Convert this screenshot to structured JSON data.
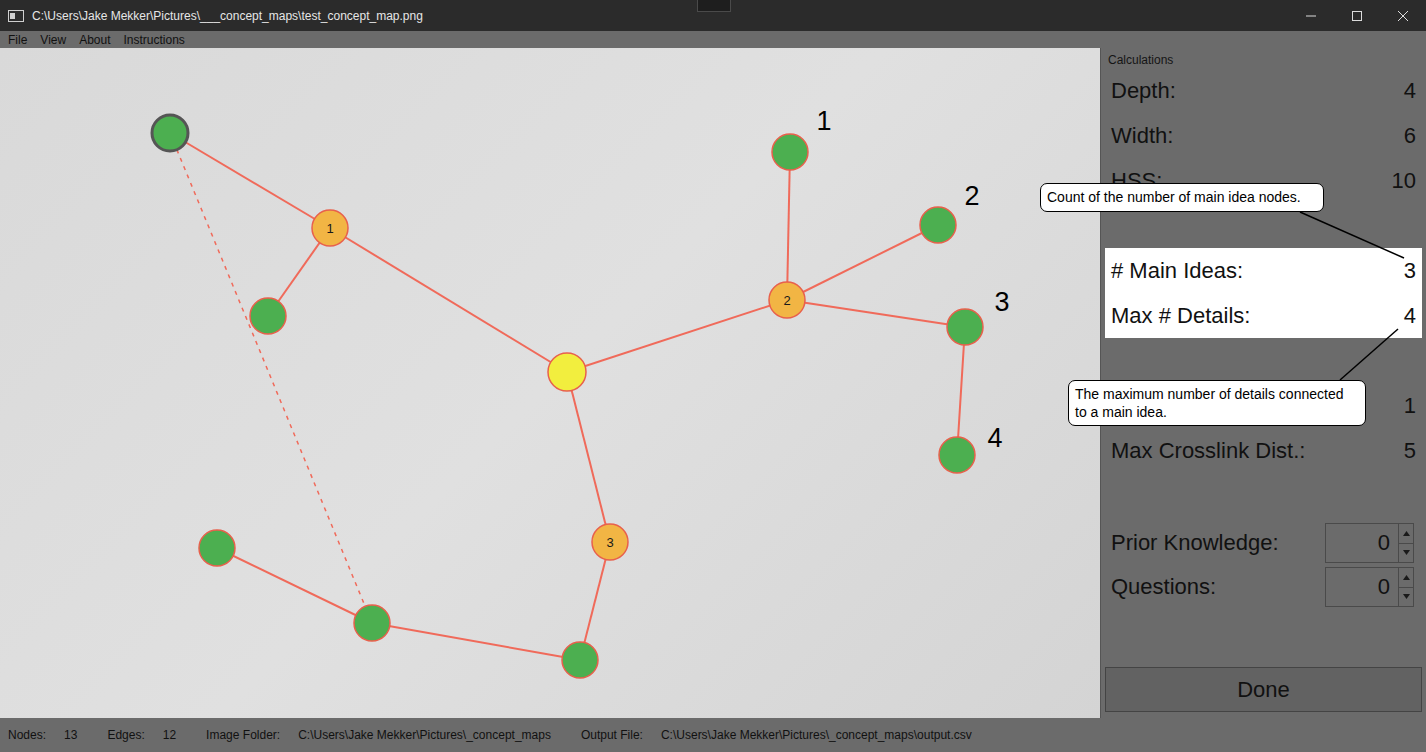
{
  "window": {
    "title": "C:\\Users\\Jake Mekker\\Pictures\\___concept_maps\\test_concept_map.png"
  },
  "menu": [
    "File",
    "View",
    "About",
    "Instructions"
  ],
  "graph": {
    "nodes": [
      {
        "kind": "root",
        "label": "",
        "color": "#f2ee3e",
        "highlighted": false
      },
      {
        "kind": "main",
        "label": "1",
        "color": "#f2b544",
        "highlighted": false
      },
      {
        "kind": "main",
        "label": "2",
        "color": "#f2b544",
        "highlighted": false
      },
      {
        "kind": "main",
        "label": "3",
        "color": "#f2b544",
        "highlighted": false
      },
      {
        "kind": "detail",
        "label": "",
        "color": "#4caf50",
        "highlighted": true
      },
      {
        "kind": "detail",
        "label": "",
        "color": "#4caf50",
        "highlighted": false
      },
      {
        "kind": "detail",
        "label": "",
        "color": "#4caf50",
        "highlighted": false
      },
      {
        "kind": "detail",
        "label": "",
        "color": "#4caf50",
        "highlighted": false
      },
      {
        "kind": "detail",
        "label": "",
        "color": "#4caf50",
        "highlighted": false
      },
      {
        "kind": "detail",
        "label": "",
        "color": "#4caf50",
        "highlighted": false
      },
      {
        "kind": "detail",
        "label": "",
        "color": "#4caf50",
        "highlighted": false
      },
      {
        "kind": "detail",
        "label": "",
        "color": "#4caf50",
        "highlighted": false
      },
      {
        "kind": "detail",
        "label": "",
        "color": "#4caf50",
        "highlighted": false
      }
    ],
    "edges": [
      {
        "from": 4,
        "to": 1,
        "dashed": false
      },
      {
        "from": 1,
        "to": 5,
        "dashed": false
      },
      {
        "from": 1,
        "to": 0,
        "dashed": false
      },
      {
        "from": 0,
        "to": 2,
        "dashed": false
      },
      {
        "from": 2,
        "to": 6,
        "dashed": false
      },
      {
        "from": 2,
        "to": 7,
        "dashed": false
      },
      {
        "from": 2,
        "to": 8,
        "dashed": false
      },
      {
        "from": 8,
        "to": 9,
        "dashed": false
      },
      {
        "from": 0,
        "to": 3,
        "dashed": false
      },
      {
        "from": 3,
        "to": 12,
        "dashed": false
      },
      {
        "from": 12,
        "to": 11,
        "dashed": false
      },
      {
        "from": 11,
        "to": 10,
        "dashed": false
      },
      {
        "from": 4,
        "to": 11,
        "dashed": true
      }
    ],
    "annotations": [
      "1",
      "2",
      "3",
      "4"
    ]
  },
  "panel": {
    "title": "Calculations",
    "rows": [
      {
        "kind": "row",
        "label": "Depth:",
        "value": "4",
        "highlighted": false
      },
      {
        "kind": "row",
        "label": "Width:",
        "value": "6",
        "highlighted": false
      },
      {
        "kind": "row",
        "label": "HSS:",
        "value": "10",
        "highlighted": false
      },
      {
        "kind": "spacer"
      },
      {
        "kind": "row",
        "label": "# Main Ideas:",
        "value": "3",
        "highlighted": true
      },
      {
        "kind": "row",
        "label": "Max # Details:",
        "value": "4",
        "highlighted": true
      },
      {
        "kind": "spacer"
      },
      {
        "kind": "row",
        "value": "1",
        "highlighted": false
      },
      {
        "kind": "row",
        "label": "Max Crosslink Dist.:",
        "value": "5",
        "highlighted": false
      }
    ],
    "spinners": [
      {
        "label": "Prior Knowledge:",
        "value": "0"
      },
      {
        "label": "Questions:",
        "value": "0"
      }
    ],
    "button": "Done"
  },
  "callouts": [
    {
      "text": "Count of the number of main idea nodes."
    },
    {
      "text": "The maximum number of details connected to a main idea."
    }
  ],
  "status_bar": [
    {
      "label": "Nodes:",
      "value": "13"
    },
    {
      "label": "Edges:",
      "value": "12"
    },
    {
      "label": "Image Folder:",
      "value": "C:\\Users\\Jake Mekker\\Pictures\\_concept_maps"
    },
    {
      "label": "Output File:",
      "value": "C:\\Users\\Jake Mekker\\Pictures\\_concept_maps\\output.csv"
    }
  ]
}
